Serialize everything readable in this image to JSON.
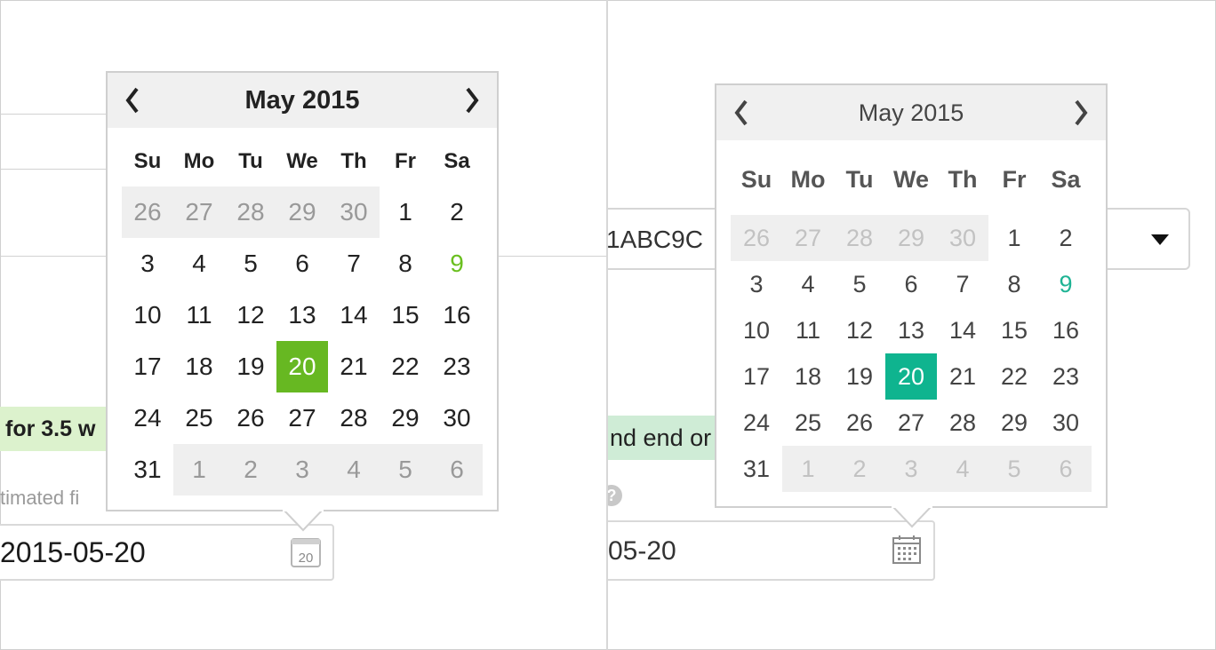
{
  "left": {
    "badge_text": "for 3.5 w",
    "field_label": "timated fi",
    "input_value": "2015-05-20",
    "calendar_icon_text": "20",
    "calendar": {
      "month_title": "May 2015",
      "weekdays": [
        "Su",
        "Mo",
        "Tu",
        "We",
        "Th",
        "Fr",
        "Sa"
      ],
      "weeks": [
        [
          "26",
          "27",
          "28",
          "29",
          "30",
          "1",
          "2"
        ],
        [
          "3",
          "4",
          "5",
          "6",
          "7",
          "8",
          "9"
        ],
        [
          "10",
          "11",
          "12",
          "13",
          "14",
          "15",
          "16"
        ],
        [
          "17",
          "18",
          "19",
          "20",
          "21",
          "22",
          "23"
        ],
        [
          "24",
          "25",
          "26",
          "27",
          "28",
          "29",
          "30"
        ],
        [
          "31",
          "1",
          "2",
          "3",
          "4",
          "5",
          "6"
        ]
      ],
      "selected_day": "20",
      "highlight_day": "9",
      "accent_color": "#67b822"
    }
  },
  "right": {
    "select_value": "1ABC9C",
    "badge_text": "nd end or",
    "input_value": "05-20",
    "calendar": {
      "month_title": "May 2015",
      "weekdays": [
        "Su",
        "Mo",
        "Tu",
        "We",
        "Th",
        "Fr",
        "Sa"
      ],
      "weeks": [
        [
          "26",
          "27",
          "28",
          "29",
          "30",
          "1",
          "2"
        ],
        [
          "3",
          "4",
          "5",
          "6",
          "7",
          "8",
          "9"
        ],
        [
          "10",
          "11",
          "12",
          "13",
          "14",
          "15",
          "16"
        ],
        [
          "17",
          "18",
          "19",
          "20",
          "21",
          "22",
          "23"
        ],
        [
          "24",
          "25",
          "26",
          "27",
          "28",
          "29",
          "30"
        ],
        [
          "31",
          "1",
          "2",
          "3",
          "4",
          "5",
          "6"
        ]
      ],
      "selected_day": "20",
      "highlight_day": "9",
      "accent_color": "#1ABC9C"
    }
  }
}
